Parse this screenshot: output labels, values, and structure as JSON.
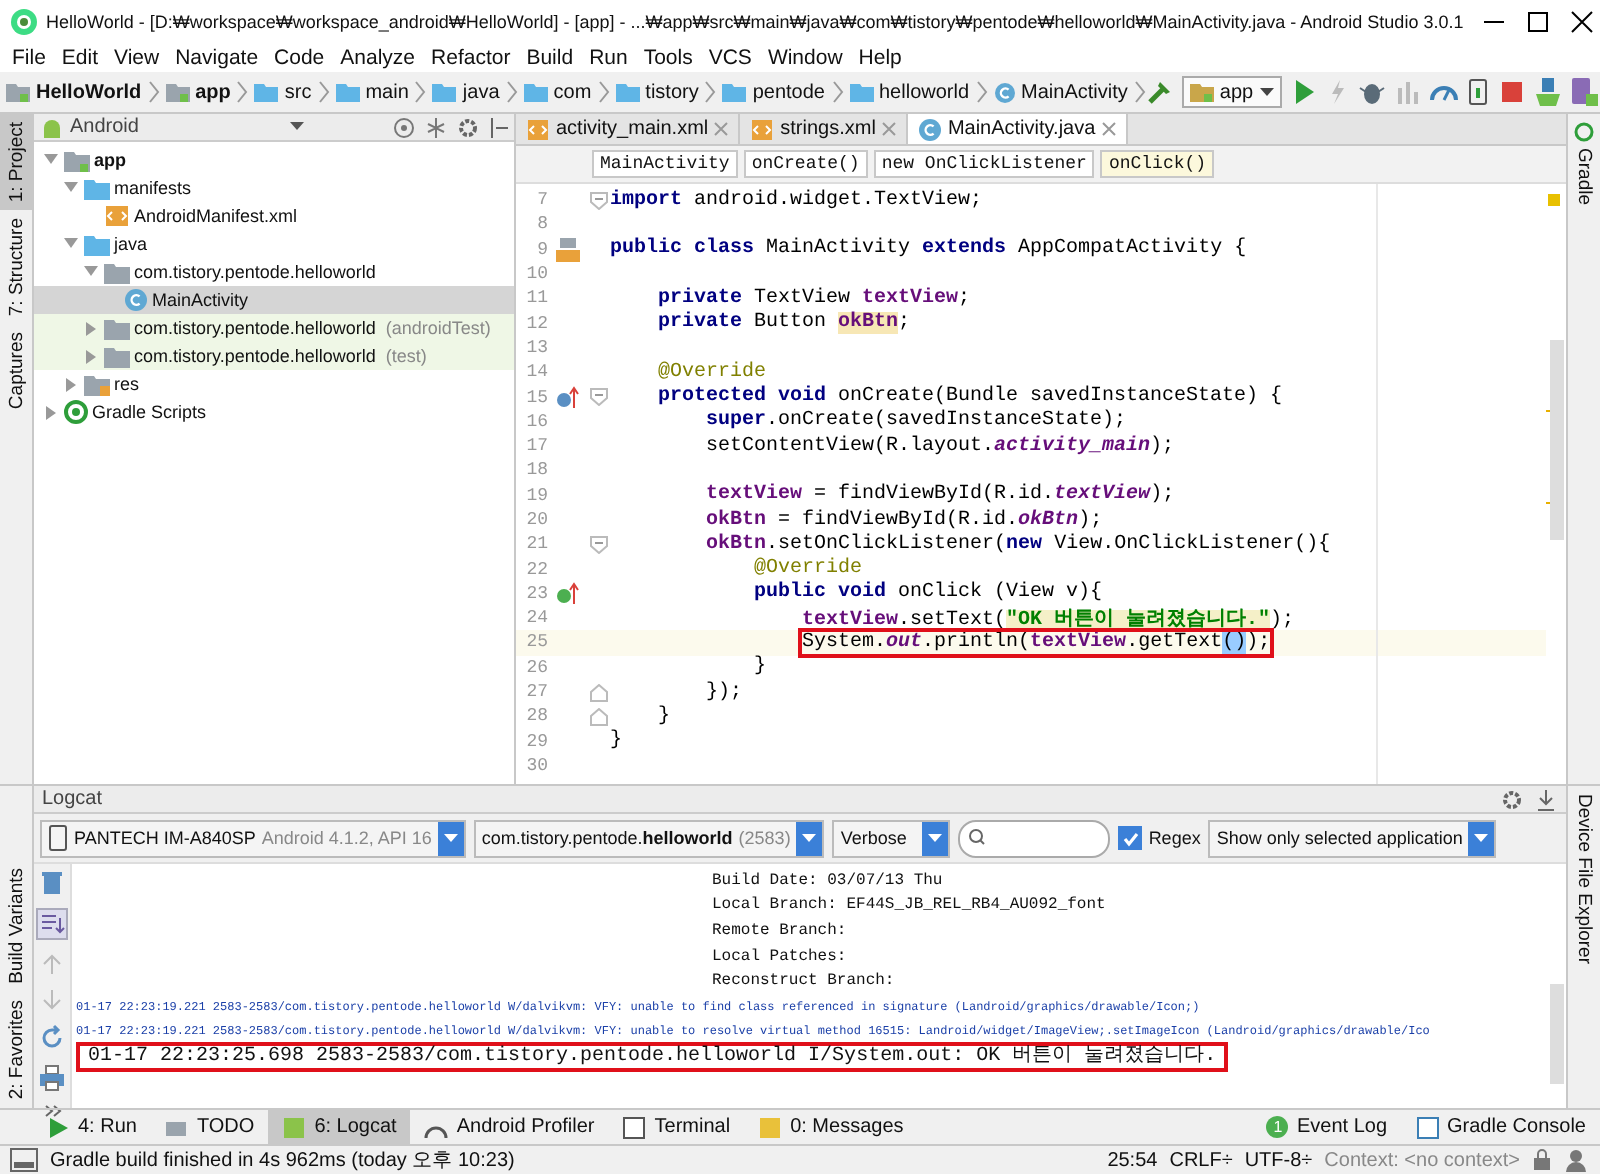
{
  "window": {
    "title": "HelloWorld - [D:₩workspace₩workspace_android₩HelloWorld] - [app] - ...₩app₩src₩main₩java₩com₩tistory₩pentode₩helloworld₩MainActivity.java - Android Studio 3.0.1"
  },
  "menu": [
    "File",
    "Edit",
    "View",
    "Navigate",
    "Code",
    "Analyze",
    "Refactor",
    "Build",
    "Run",
    "Tools",
    "VCS",
    "Window",
    "Help"
  ],
  "breadcrumbs": [
    {
      "label": "HelloWorld",
      "kind": "project"
    },
    {
      "label": "app",
      "kind": "module"
    },
    {
      "label": "src",
      "kind": "folder"
    },
    {
      "label": "main",
      "kind": "folder"
    },
    {
      "label": "java",
      "kind": "source"
    },
    {
      "label": "com",
      "kind": "folder"
    },
    {
      "label": "tistory",
      "kind": "folder"
    },
    {
      "label": "pentode",
      "kind": "folder"
    },
    {
      "label": "helloworld",
      "kind": "folder"
    },
    {
      "label": "MainActivity",
      "kind": "class"
    }
  ],
  "run_config": "app",
  "left_strip": [
    {
      "label": "1: Project",
      "selected": true
    },
    {
      "label": "7: Structure",
      "selected": false
    },
    {
      "label": "Captures",
      "selected": false
    }
  ],
  "left_strip_bottom": [
    {
      "label": "Build Variants",
      "selected": false
    },
    {
      "label": "2: Favorites",
      "selected": false
    }
  ],
  "right_strip": [
    {
      "label": "Gradle",
      "selected": false
    }
  ],
  "right_strip_bottom": [
    {
      "label": "Device File Explorer",
      "selected": false
    }
  ],
  "project_panel": {
    "view": "Android",
    "tree": [
      {
        "label": "app",
        "kind": "module",
        "expanded": true,
        "selected": false,
        "children": [
          {
            "label": "manifests",
            "kind": "folder",
            "expanded": true,
            "selected": false,
            "children": [
              {
                "label": "AndroidManifest.xml",
                "kind": "xml",
                "selected": false
              }
            ]
          },
          {
            "label": "java",
            "kind": "folder",
            "expanded": true,
            "selected": false,
            "children": [
              {
                "label": "com.tistory.pentode.helloworld",
                "kind": "package",
                "expanded": true,
                "selected": false,
                "children": [
                  {
                    "label": "MainActivity",
                    "kind": "class",
                    "selected": true
                  }
                ]
              },
              {
                "label": "com.tistory.pentode.helloworld",
                "suffix": "(androidTest)",
                "kind": "test-package",
                "expanded": false,
                "selected": false
              },
              {
                "label": "com.tistory.pentode.helloworld",
                "suffix": "(test)",
                "kind": "test-package",
                "expanded": false,
                "selected": false
              }
            ]
          },
          {
            "label": "res",
            "kind": "res",
            "expanded": false,
            "selected": false
          }
        ]
      },
      {
        "label": "Gradle Scripts",
        "kind": "gradle",
        "expanded": false,
        "selected": false
      }
    ]
  },
  "editor": {
    "tabs": [
      {
        "label": "activity_main.xml",
        "kind": "xml",
        "selected": false
      },
      {
        "label": "strings.xml",
        "kind": "xml",
        "selected": false
      },
      {
        "label": "MainActivity.java",
        "kind": "class",
        "selected": true
      }
    ],
    "scope_chips": [
      {
        "label": "MainActivity",
        "selected": false
      },
      {
        "label": "onCreate()",
        "selected": false
      },
      {
        "label": "new OnClickListener",
        "selected": false
      },
      {
        "label": "onClick()",
        "selected": true
      }
    ],
    "lines": [
      {
        "number": "7",
        "fold": {
          "kind": "open"
        },
        "tokens": [
          {
            "text": "import",
            "kind": "keyword"
          },
          {
            "text": " android.widget.TextView;",
            "kind": "plain"
          }
        ]
      },
      {
        "number": "8"
      },
      {
        "number": "9",
        "gutter_icon": {
          "kind": "layout"
        },
        "tokens": [
          {
            "text": "public class",
            "kind": "keyword"
          },
          {
            "text": " MainActivity ",
            "kind": "plain"
          },
          {
            "text": "extends",
            "kind": "keyword"
          },
          {
            "text": " AppCompatActivity {",
            "kind": "plain"
          }
        ]
      },
      {
        "number": "10"
      },
      {
        "number": "11",
        "tokens": [
          {
            "text": "    private",
            "kind": "keyword"
          },
          {
            "text": " TextView ",
            "kind": "plain"
          },
          {
            "text": "textView",
            "kind": "field"
          },
          {
            "text": ";",
            "kind": "plain"
          }
        ]
      },
      {
        "number": "12",
        "tokens": [
          {
            "text": "    private",
            "kind": "keyword"
          },
          {
            "text": " Button ",
            "kind": "plain"
          },
          {
            "text": "okBtn",
            "kind": "usage"
          },
          {
            "text": ";",
            "kind": "plain"
          }
        ]
      },
      {
        "number": "13"
      },
      {
        "number": "14",
        "tokens": [
          {
            "text": "    @Override",
            "kind": "annotation"
          }
        ]
      },
      {
        "number": "15",
        "gutter_icon": {
          "kind": "override"
        },
        "fold": {
          "kind": "open"
        },
        "tokens": [
          {
            "text": "    protected void",
            "kind": "keyword"
          },
          {
            "text": " onCreate(Bundle savedInstanceState) {",
            "kind": "plain"
          }
        ]
      },
      {
        "number": "16",
        "tokens": [
          {
            "text": "        super",
            "kind": "keyword"
          },
          {
            "text": ".onCreate(savedInstanceState);",
            "kind": "plain"
          }
        ]
      },
      {
        "number": "17",
        "tokens": [
          {
            "text": "        setContentView(R.layout.",
            "kind": "plain"
          },
          {
            "text": "activity_main",
            "kind": "static"
          },
          {
            "text": ");",
            "kind": "plain"
          }
        ]
      },
      {
        "number": "18"
      },
      {
        "number": "19",
        "tokens": [
          {
            "text": "        textView",
            "kind": "field"
          },
          {
            "text": " = findViewById(R.id.",
            "kind": "plain"
          },
          {
            "text": "textView",
            "kind": "static"
          },
          {
            "text": ");",
            "kind": "plain"
          }
        ]
      },
      {
        "number": "20",
        "tokens": [
          {
            "text": "        okBtn",
            "kind": "field"
          },
          {
            "text": " = findViewById(R.id.",
            "kind": "plain"
          },
          {
            "text": "okBtn",
            "kind": "static"
          },
          {
            "text": ");",
            "kind": "plain"
          }
        ]
      },
      {
        "number": "21",
        "fold": {
          "kind": "open"
        },
        "tokens": [
          {
            "text": "        okBtn",
            "kind": "field"
          },
          {
            "text": ".setOnClickListener(",
            "kind": "plain"
          },
          {
            "text": "new",
            "kind": "keyword"
          },
          {
            "text": " View.OnClickListener(){",
            "kind": "plain"
          }
        ]
      },
      {
        "number": "22",
        "tokens": [
          {
            "text": "            @Override",
            "kind": "annotation"
          }
        ]
      },
      {
        "number": "23",
        "gutter_icon": {
          "kind": "implement"
        },
        "tokens": [
          {
            "text": "            public void",
            "kind": "keyword"
          },
          {
            "text": " onClick (View v){",
            "kind": "plain"
          }
        ]
      },
      {
        "number": "24",
        "tokens": [
          {
            "text": "                textView",
            "kind": "field"
          },
          {
            "text": ".setText(",
            "kind": "plain"
          },
          {
            "text": "\"OK 버튼이 눌려졌습니다.\"",
            "kind": "string"
          },
          {
            "text": ");",
            "kind": "plain"
          }
        ]
      },
      {
        "number": "25",
        "current": true,
        "boxed": true,
        "tokens": [
          {
            "text": "                System.",
            "kind": "plain"
          },
          {
            "text": "out",
            "kind": "static"
          },
          {
            "text": ".println(",
            "kind": "plain"
          },
          {
            "text": "textView",
            "kind": "field"
          },
          {
            "text": ".getText",
            "kind": "plain"
          },
          {
            "text": "()",
            "kind": "brace"
          },
          {
            "text": ");",
            "kind": "plain"
          }
        ]
      },
      {
        "number": "26",
        "tokens": [
          {
            "text": "            }",
            "kind": "plain"
          }
        ]
      },
      {
        "number": "27",
        "fold": {
          "kind": "close"
        },
        "tokens": [
          {
            "text": "        });",
            "kind": "plain"
          }
        ]
      },
      {
        "number": "28",
        "fold": {
          "kind": "close"
        },
        "tokens": [
          {
            "text": "    }",
            "kind": "plain"
          }
        ]
      },
      {
        "number": "29",
        "tokens": [
          {
            "text": "}",
            "kind": "plain"
          }
        ]
      },
      {
        "number": "30"
      }
    ]
  },
  "logcat": {
    "title": "Logcat",
    "device": {
      "name": "PANTECH IM-A840SP",
      "detail": "Android 4.1.2, API 16"
    },
    "process": {
      "name": "com.tistory.pentode.**helloworld**",
      "pid": "(2583)"
    },
    "level": "Verbose",
    "regex": {
      "label": "Regex",
      "checked": true
    },
    "filter": "Show only selected application",
    "lines": [
      {
        "text": "Build Date: 03/07/13 Thu",
        "kind": "continuation",
        "boxed": false
      },
      {
        "text": "Local Branch: EF44S_JB_REL_RB4_AU092_font",
        "kind": "continuation",
        "boxed": false
      },
      {
        "text": "Remote Branch:",
        "kind": "continuation",
        "boxed": false
      },
      {
        "text": "Local Patches:",
        "kind": "continuation",
        "boxed": false
      },
      {
        "text": "Reconstruct Branch:",
        "kind": "continuation",
        "boxed": false
      },
      {
        "text": "01-17 22:23:19.221 2583-2583/com.tistory.pentode.helloworld W/dalvikvm: VFY: unable to find class referenced in signature (Landroid/graphics/drawable/Icon;)",
        "kind": "warn",
        "boxed": false
      },
      {
        "text": "01-17 22:23:19.221 2583-2583/com.tistory.pentode.helloworld W/dalvikvm: VFY: unable to resolve virtual method 16515: Landroid/widget/ImageView;.setImageIcon (Landroid/graphics/drawable/Ico",
        "kind": "warn",
        "boxed": false
      },
      {
        "text": "01-17 22:23:25.698 2583-2583/com.tistory.pentode.helloworld I/System.out: OK 버튼이 눌려졌습니다.",
        "kind": "info",
        "boxed": true
      }
    ]
  },
  "tool_tabs": [
    {
      "label": "4: Run",
      "kind": "run",
      "selected": false
    },
    {
      "label": "TODO",
      "kind": "todo",
      "selected": false
    },
    {
      "label": "6: Logcat",
      "kind": "logcat",
      "selected": true
    },
    {
      "label": "Android Profiler",
      "kind": "profiler",
      "selected": false
    },
    {
      "label": "Terminal",
      "kind": "terminal",
      "selected": false
    },
    {
      "label": "0: Messages",
      "kind": "messages",
      "selected": false
    }
  ],
  "tool_tabs_right": [
    {
      "label": "Event Log",
      "kind": "event",
      "badge": "1"
    },
    {
      "label": "Gradle Console",
      "kind": "console"
    }
  ],
  "status_bar": {
    "message": "Gradle build finished in 4s 962ms (today 오후 10:23)",
    "position": "25:54",
    "line_separator": "CRLF÷",
    "encoding": "UTF-8÷",
    "context": "Context: <no context>"
  }
}
